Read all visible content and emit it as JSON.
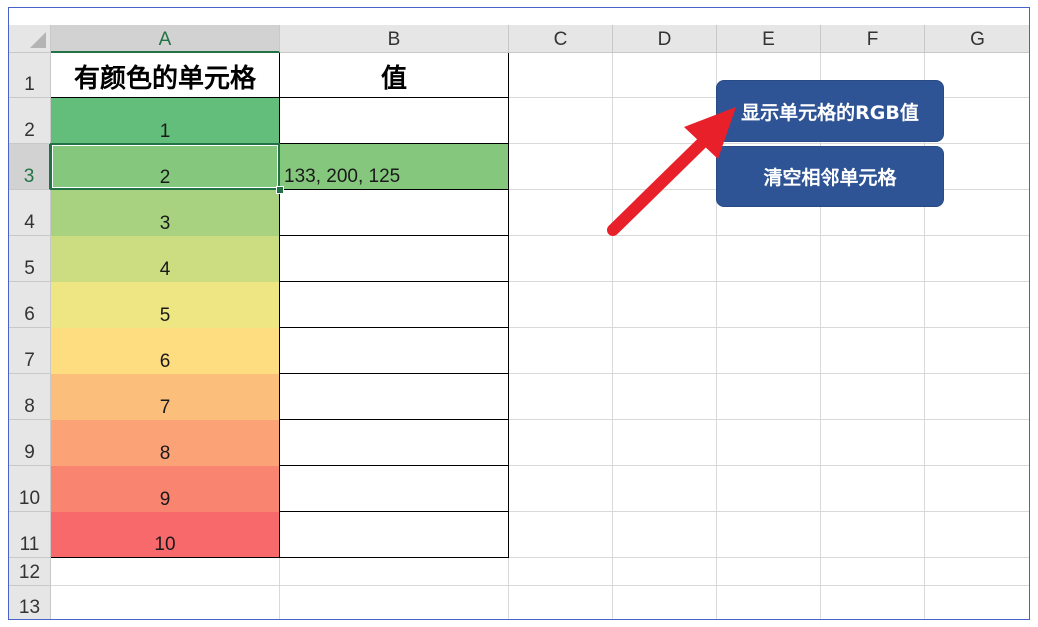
{
  "columns": [
    "A",
    "B",
    "C",
    "D",
    "E",
    "F",
    "G"
  ],
  "active_column": "A",
  "rows": [
    "1",
    "2",
    "3",
    "4",
    "5",
    "6",
    "7",
    "8",
    "9",
    "10",
    "11",
    "12",
    "13"
  ],
  "active_row": "3",
  "header": {
    "a1": "有颜色的单元格",
    "b1": "值"
  },
  "a_cells": [
    {
      "value": "1",
      "fill": "#63be7b"
    },
    {
      "value": "2",
      "fill": "#85c87d"
    },
    {
      "value": "3",
      "fill": "#a8d27f"
    },
    {
      "value": "4",
      "fill": "#cbdc81"
    },
    {
      "value": "5",
      "fill": "#eee683"
    },
    {
      "value": "6",
      "fill": "#fedd81"
    },
    {
      "value": "7",
      "fill": "#fcbf7b"
    },
    {
      "value": "8",
      "fill": "#fba276"
    },
    {
      "value": "9",
      "fill": "#f98570"
    },
    {
      "value": "10",
      "fill": "#f8696b"
    }
  ],
  "b_cells": [
    {
      "value": "",
      "fill": ""
    },
    {
      "value": "133, 200, 125",
      "fill": "#85c87d"
    },
    {
      "value": "",
      "fill": ""
    },
    {
      "value": "",
      "fill": ""
    },
    {
      "value": "",
      "fill": ""
    },
    {
      "value": "",
      "fill": ""
    },
    {
      "value": "",
      "fill": ""
    },
    {
      "value": "",
      "fill": ""
    },
    {
      "value": "",
      "fill": ""
    },
    {
      "value": "",
      "fill": ""
    }
  ],
  "buttons": {
    "show_rgb": "显示单元格的RGB值",
    "clear_adjacent": "清空相邻单元格"
  },
  "colors": {
    "button_bg": "#2f5496",
    "arrow": "#e8202a",
    "selection": "#217346"
  }
}
